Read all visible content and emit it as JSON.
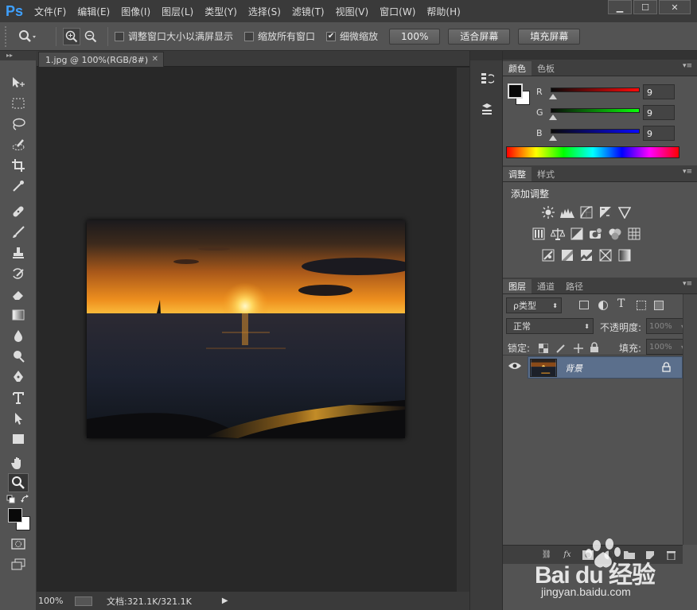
{
  "app": {
    "logo": "Ps"
  },
  "menu": [
    "文件(F)",
    "编辑(E)",
    "图像(I)",
    "图层(L)",
    "类型(Y)",
    "选择(S)",
    "滤镜(T)",
    "视图(V)",
    "窗口(W)",
    "帮助(H)"
  ],
  "window_controls": {
    "minimize": "▁",
    "maximize": "☐",
    "close": "✕"
  },
  "options": {
    "resize_windows_label": "调整窗口大小以满屏显示",
    "resize_windows_checked": false,
    "zoom_all_label": "缩放所有窗口",
    "zoom_all_checked": false,
    "scrubby_zoom_label": "细微缩放",
    "scrubby_zoom_checked": true,
    "btn_100": "100%",
    "btn_fit": "适合屏幕",
    "btn_fill": "填充屏幕"
  },
  "document": {
    "tab_title": "1.jpg @ 100%(RGB/8#)",
    "zoom": "100%",
    "doc_info": "文档:321.1K/321.1K"
  },
  "color_panel": {
    "tabs": [
      "颜色",
      "色板"
    ],
    "r_label": "R",
    "r_value": "9",
    "g_label": "G",
    "g_value": "9",
    "b_label": "B",
    "b_value": "9",
    "foreground": "#090909",
    "background": "#ffffff"
  },
  "adjust_panel": {
    "tabs": [
      "调整",
      "样式"
    ],
    "heading": "添加调整"
  },
  "layers_panel": {
    "tabs": [
      "图层",
      "通道",
      "路径"
    ],
    "filter_kind": "ρ类型",
    "blend_mode": "正常",
    "opacity_label": "不透明度:",
    "opacity_value": "100%",
    "lock_label": "锁定:",
    "fill_label": "填充:",
    "fill_value": "100%",
    "layer_name": "背景"
  },
  "watermark": {
    "brand": "Bai du 经验",
    "url": "jingyan.baidu.com"
  }
}
